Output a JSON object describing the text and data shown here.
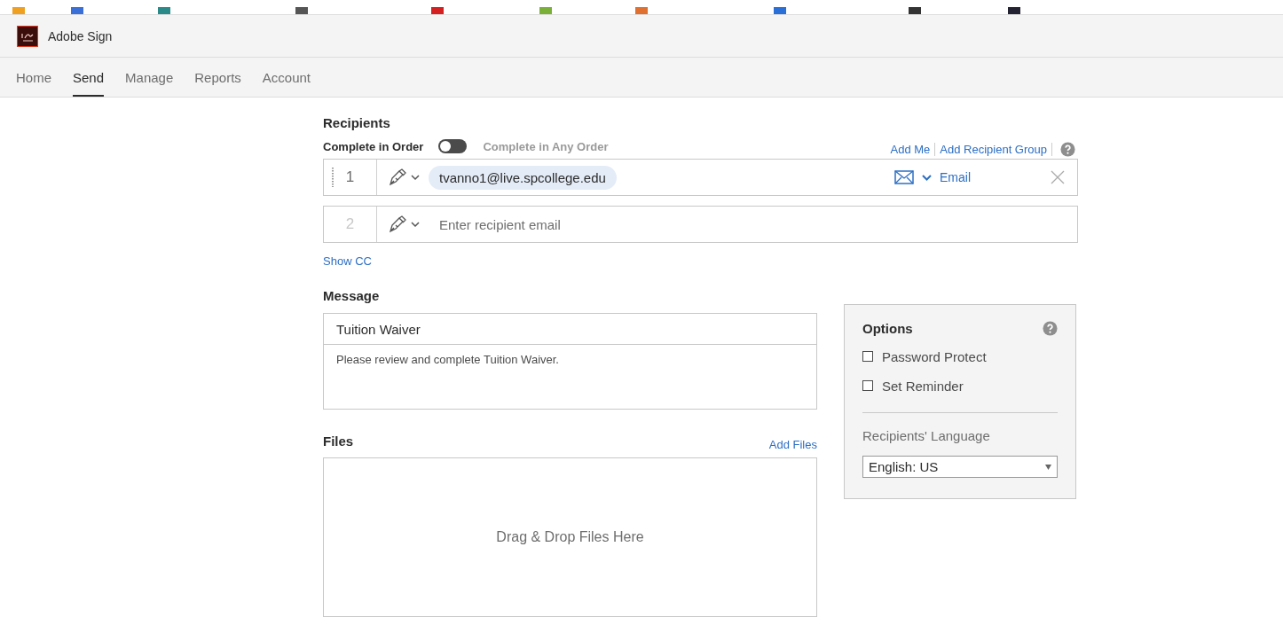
{
  "app": {
    "title": "Adobe Sign"
  },
  "nav": [
    {
      "label": "Home",
      "selected": false
    },
    {
      "label": "Send",
      "selected": true
    },
    {
      "label": "Manage",
      "selected": false
    },
    {
      "label": "Reports",
      "selected": false
    },
    {
      "label": "Account",
      "selected": false
    }
  ],
  "recipients": {
    "heading": "Recipients",
    "order_label": "Complete in Order",
    "order_toggle_on": false,
    "any_order_label": "Complete in Any Order",
    "links": [
      "Add Me",
      "Add Recipient Group"
    ],
    "rows": [
      {
        "number": "1",
        "value": "tvanno1@live.spcollege.edu",
        "delivery": "Email"
      },
      {
        "number": "2",
        "placeholder": "Enter recipient email"
      }
    ],
    "show_cc": "Show CC"
  },
  "message": {
    "heading": "Message",
    "subject": "Tuition Waiver",
    "body": "Please review and complete Tuition Waiver."
  },
  "files": {
    "heading": "Files",
    "add_link": "Add Files",
    "drop_text": "Drag & Drop Files Here"
  },
  "options": {
    "heading": "Options",
    "checkboxes": [
      {
        "label": "Password Protect",
        "checked": false
      },
      {
        "label": "Set Reminder",
        "checked": false
      }
    ],
    "language_label": "Recipients' Language",
    "language": "English: US"
  }
}
